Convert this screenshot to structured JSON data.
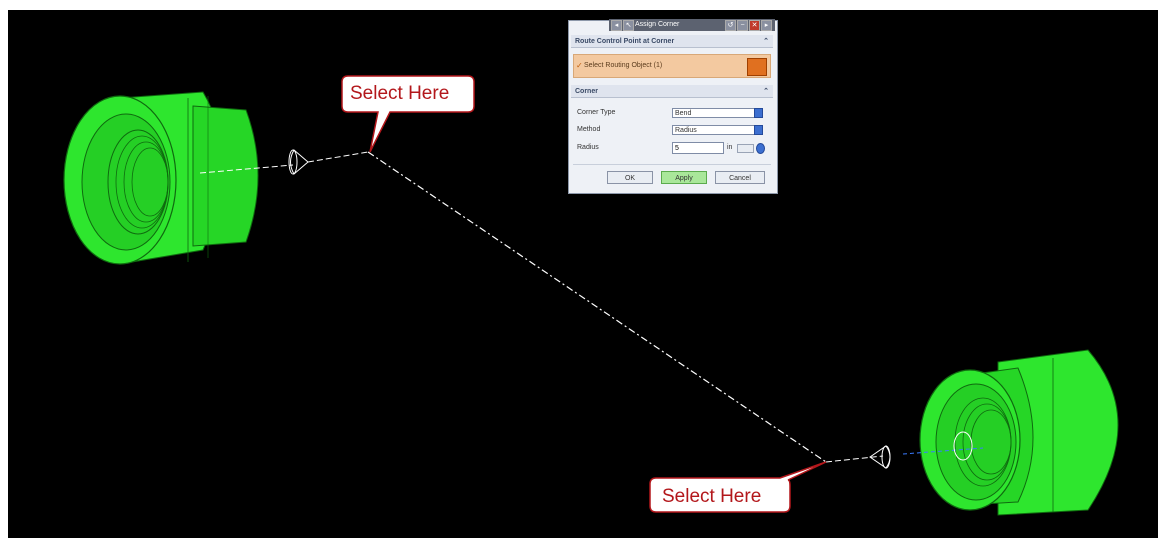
{
  "dialog": {
    "title": "Assign Corner",
    "group1_title": "Route Control Point at Corner",
    "select_label": "Select Routing Object (1)",
    "group2_title": "Corner",
    "corner_type_label": "Corner Type",
    "corner_type_value": "Bend",
    "method_label": "Method",
    "method_value": "Radius",
    "radius_label": "Radius",
    "radius_value": "5",
    "radius_unit": "in",
    "ok_label": "OK",
    "apply_label": "Apply",
    "cancel_label": "Cancel"
  },
  "callouts": {
    "top_text": "Select Here",
    "bottom_text": "Select Here"
  },
  "colors": {
    "part_green": "#2ee62e",
    "callout_text": "#b3171b",
    "viewport_bg": "#000000",
    "apply_green": "#a9e79a"
  },
  "icons": {
    "select_object": "orange-selection-icon",
    "collapse": "chevron-up-icon",
    "dropdown": "blue-dropdown-icon"
  }
}
